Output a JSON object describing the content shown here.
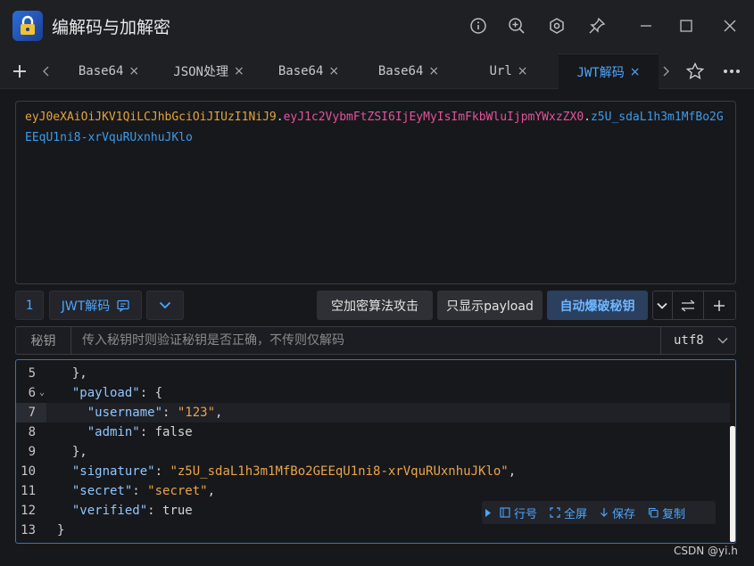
{
  "app": {
    "title": "编解码与加解密"
  },
  "window_controls": [
    "info-icon",
    "zoom-in-icon",
    "settings-icon",
    "pin-icon",
    "minimize-icon",
    "maximize-icon",
    "close-icon"
  ],
  "tabs": [
    {
      "label": "Base64",
      "active": false
    },
    {
      "label": "JSON处理",
      "active": false
    },
    {
      "label": "Base64",
      "active": false
    },
    {
      "label": "Base64",
      "active": false
    },
    {
      "label": "Url",
      "active": false
    },
    {
      "label": "JWT解码",
      "active": true
    }
  ],
  "tab_close_glyph": "×",
  "jwt": {
    "header": "eyJ0eXAiOiJKV1QiLCJhbGciOiJIUzI1NiJ9",
    "payload": "eyJ1c2VybmFtZSI6IjEyMyIsImFkbWluIjpmYWxzZX0",
    "signature": "z5U_sdaL1h3m1MfBo2GEEqU1ni8-xrVquRUxnhuJKlo",
    "dot": "."
  },
  "toolbar": {
    "count": "1",
    "mode_label": "JWT解码",
    "attack_label": "空加密算法攻击",
    "payload_only_label": "只显示payload",
    "brute_label": "自动爆破秘钥"
  },
  "secret": {
    "label": "秘钥",
    "placeholder": "传入秘钥时则验证秘钥是否正确，不传则仅解码",
    "value": "",
    "encoding": "utf8"
  },
  "code": {
    "lines": [
      {
        "n": "5",
        "parts": [
          {
            "t": "p",
            "v": "  },"
          }
        ]
      },
      {
        "n": "6",
        "fold": true,
        "parts": [
          {
            "t": "p",
            "v": "  "
          },
          {
            "t": "k",
            "v": "\"payload\""
          },
          {
            "t": "p",
            "v": ": {"
          }
        ]
      },
      {
        "n": "7",
        "current": true,
        "parts": [
          {
            "t": "p",
            "v": "    "
          },
          {
            "t": "k",
            "v": "\"username\""
          },
          {
            "t": "p",
            "v": ": "
          },
          {
            "t": "s",
            "v": "\"123\""
          },
          {
            "t": "p",
            "v": ","
          }
        ]
      },
      {
        "n": "8",
        "parts": [
          {
            "t": "p",
            "v": "    "
          },
          {
            "t": "k",
            "v": "\"admin\""
          },
          {
            "t": "p",
            "v": ": false"
          }
        ]
      },
      {
        "n": "9",
        "parts": [
          {
            "t": "p",
            "v": "  },"
          }
        ]
      },
      {
        "n": "10",
        "parts": [
          {
            "t": "p",
            "v": "  "
          },
          {
            "t": "k",
            "v": "\"signature\""
          },
          {
            "t": "p",
            "v": ": "
          },
          {
            "t": "s",
            "v": "\"z5U_sdaL1h3m1MfBo2GEEqU1ni8-xrVquRUxnhuJKlo\""
          },
          {
            "t": "p",
            "v": ","
          }
        ]
      },
      {
        "n": "11",
        "parts": [
          {
            "t": "p",
            "v": "  "
          },
          {
            "t": "k",
            "v": "\"secret\""
          },
          {
            "t": "p",
            "v": ": "
          },
          {
            "t": "s",
            "v": "\"secret\""
          },
          {
            "t": "p",
            "v": ","
          }
        ]
      },
      {
        "n": "12",
        "parts": [
          {
            "t": "p",
            "v": "  "
          },
          {
            "t": "k",
            "v": "\"verified\""
          },
          {
            "t": "p",
            "v": ": true"
          }
        ]
      },
      {
        "n": "13",
        "parts": [
          {
            "t": "p",
            "v": "}"
          }
        ]
      }
    ],
    "tools": {
      "line_numbers": "行号",
      "fullscreen": "全屏",
      "save": "保存",
      "copy": "复制"
    }
  },
  "watermark": "CSDN @yi.h",
  "colors": {
    "accent": "#4ea6ff",
    "jwt_header": "#e3a33c",
    "jwt_payload": "#e6529c",
    "jwt_signature": "#3d9be9"
  }
}
